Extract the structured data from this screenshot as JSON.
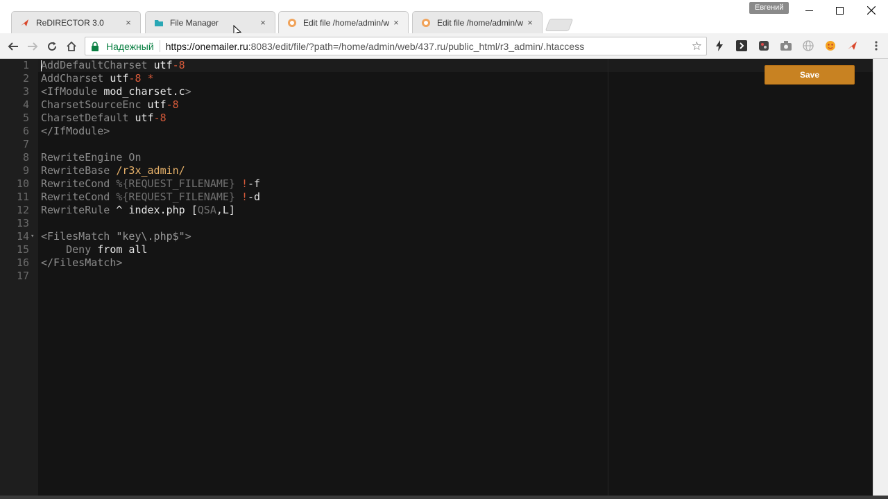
{
  "browser": {
    "profile_name": "Евгений",
    "tabs": [
      {
        "title": "ReDIRECTOR 3.0",
        "favicon": "redirector-icon",
        "active": false
      },
      {
        "title": "File Manager",
        "favicon": "folder-icon",
        "active": false
      },
      {
        "title": "Edit file /home/admin/w",
        "favicon": "vesta-icon",
        "active": true
      },
      {
        "title": "Edit file /home/admin/w",
        "favicon": "vesta-icon",
        "active": false
      }
    ],
    "tab_close_glyph": "×",
    "security_label": "Надежный",
    "url_host": "https://onemailer.ru",
    "url_rest": ":8083/edit/file/?path=/home/admin/web/437.ru/public_html/r3_admin/.htaccess"
  },
  "editor": {
    "save_label": "Save",
    "lines": [
      {
        "n": "1",
        "tokens": [
          {
            "c": "t-dir",
            "t": "AddDefaultCharset "
          },
          {
            "c": "t-txt",
            "t": "utf"
          },
          {
            "c": "t-num",
            "t": "-8"
          }
        ]
      },
      {
        "n": "2",
        "tokens": [
          {
            "c": "t-dir",
            "t": "AddCharset "
          },
          {
            "c": "t-txt",
            "t": "utf"
          },
          {
            "c": "t-num",
            "t": "-8 *"
          }
        ]
      },
      {
        "n": "3",
        "tokens": [
          {
            "c": "t-tag",
            "t": "<IfModule "
          },
          {
            "c": "t-txt",
            "t": "mod_charset.c"
          },
          {
            "c": "t-tag",
            "t": ">"
          }
        ]
      },
      {
        "n": "4",
        "tokens": [
          {
            "c": "t-dir",
            "t": "CharsetSourceEnc "
          },
          {
            "c": "t-txt",
            "t": "utf"
          },
          {
            "c": "t-num",
            "t": "-8"
          }
        ]
      },
      {
        "n": "5",
        "tokens": [
          {
            "c": "t-dir",
            "t": "CharsetDefault "
          },
          {
            "c": "t-txt",
            "t": "utf"
          },
          {
            "c": "t-num",
            "t": "-8"
          }
        ]
      },
      {
        "n": "6",
        "tokens": [
          {
            "c": "t-tag",
            "t": "</IfModule>"
          }
        ]
      },
      {
        "n": "7",
        "tokens": []
      },
      {
        "n": "8",
        "tokens": [
          {
            "c": "t-dir",
            "t": "RewriteEngine On"
          }
        ]
      },
      {
        "n": "9",
        "tokens": [
          {
            "c": "t-dir",
            "t": "RewriteBase "
          },
          {
            "c": "t-path",
            "t": "/r3x_admin/"
          }
        ]
      },
      {
        "n": "10",
        "tokens": [
          {
            "c": "t-dir",
            "t": "RewriteCond "
          },
          {
            "c": "t-var",
            "t": "%{REQUEST_FILENAME} "
          },
          {
            "c": "t-num",
            "t": "!"
          },
          {
            "c": "t-txt",
            "t": "-f"
          }
        ]
      },
      {
        "n": "11",
        "tokens": [
          {
            "c": "t-dir",
            "t": "RewriteCond "
          },
          {
            "c": "t-var",
            "t": "%{REQUEST_FILENAME} "
          },
          {
            "c": "t-num",
            "t": "!"
          },
          {
            "c": "t-txt",
            "t": "-d"
          }
        ]
      },
      {
        "n": "12",
        "tokens": [
          {
            "c": "t-dir",
            "t": "RewriteRule "
          },
          {
            "c": "t-txt",
            "t": "^ index.php ["
          },
          {
            "c": "t-var",
            "t": "QSA"
          },
          {
            "c": "t-txt",
            "t": ",L]"
          }
        ]
      },
      {
        "n": "13",
        "tokens": []
      },
      {
        "n": "14",
        "fold": true,
        "tokens": [
          {
            "c": "t-tag",
            "t": "<FilesMatch "
          },
          {
            "c": "t-str",
            "t": "\"key\\.php$\""
          },
          {
            "c": "t-tag",
            "t": ">"
          }
        ]
      },
      {
        "n": "15",
        "tokens": [
          {
            "c": "t-txt",
            "t": "    "
          },
          {
            "c": "t-dir",
            "t": "Deny "
          },
          {
            "c": "t-txt",
            "t": "from all"
          }
        ]
      },
      {
        "n": "16",
        "tokens": [
          {
            "c": "t-tag",
            "t": "</FilesMatch>"
          }
        ]
      },
      {
        "n": "17",
        "tokens": []
      }
    ]
  }
}
